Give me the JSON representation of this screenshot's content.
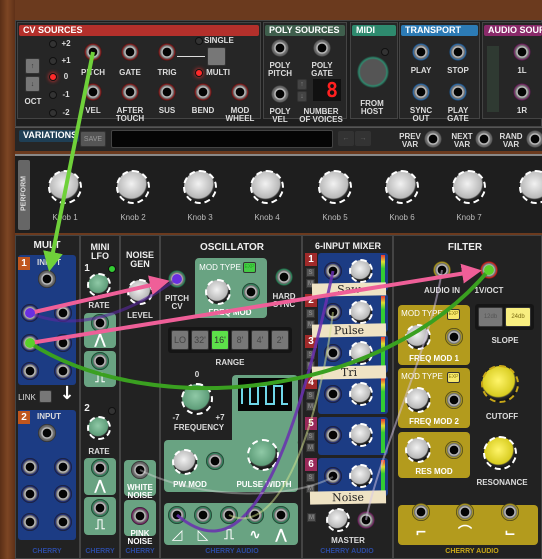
{
  "cv_sources": {
    "title": "CV SOURCES",
    "oct_label": "OCT",
    "levels": [
      "+2",
      "+1",
      "0",
      "-1",
      "-2"
    ],
    "active_level": "0",
    "pitch": "PITCH",
    "gate": "GATE",
    "trig": "TRIG",
    "single": "SINGLE",
    "multi": "MULTI",
    "vel": "VEL",
    "after_touch": "AFTER\nTOUCH",
    "sus": "SUS",
    "bend": "BEND",
    "mod_wheel": "MOD\nWHEEL"
  },
  "poly_sources": {
    "title": "POLY SOURCES",
    "poly_pitch": "POLY\nPITCH",
    "poly_gate": "POLY\nGATE",
    "poly_vel": "POLY\nVEL",
    "voices_label": "NUMBER\nOF VOICES",
    "voices": "8"
  },
  "midi": {
    "title": "MIDI",
    "from_host": "FROM\nHOST"
  },
  "transport": {
    "title": "TRANSPORT",
    "play": "PLAY",
    "stop": "STOP",
    "sync_out": "SYNC\nOUT",
    "play_gate": "PLAY\nGATE"
  },
  "audio_sources": {
    "title": "AUDIO SOURCES",
    "l": "1L",
    "r": "1R"
  },
  "variations": {
    "title": "VARIATIONS",
    "save": "SAVE",
    "name": "",
    "prev": "PREV\nVAR",
    "next": "NEXT\nVAR",
    "rand": "RAND\nVAR"
  },
  "perform": {
    "title": "PERFORM",
    "knobs": [
      "Knob 1",
      "Knob 2",
      "Knob 3",
      "Knob 4",
      "Knob 5",
      "Knob 6",
      "Knob 7"
    ]
  },
  "mult": {
    "title": "MULT",
    "ch1": "1",
    "ch2": "2",
    "input": "INPUT",
    "link": "LINK",
    "footer": "CHERRY"
  },
  "mini_lfo": {
    "title": "MINI\nLFO",
    "ch1": "1",
    "ch2": "2",
    "rate": "RATE",
    "footer": "CHERRY"
  },
  "noise_gen": {
    "title": "NOISE\nGEN",
    "level": "LEVEL",
    "white": "WHITE\nNOISE",
    "pink": "PINK\nNOISE",
    "footer": "CHERRY"
  },
  "oscillator": {
    "title": "OSCILLATOR",
    "pitch_cv": "PITCH\nCV",
    "mod_type": "MOD TYPE",
    "exp": "EXP",
    "freq_mod": "FREQ MOD",
    "hard_sync": "HARD\nSYNC",
    "range_options": [
      "LO",
      "32'",
      "16'",
      "8'",
      "4'",
      "2'"
    ],
    "range_selected": "16'",
    "range": "RANGE",
    "freq_zero": "0",
    "freq_min": "-7",
    "freq_max": "+7",
    "frequency": "FREQUENCY",
    "pw_mod": "PW MOD",
    "pulse_width": "PULSE WIDTH",
    "footer": "CHERRY AUDIO"
  },
  "mixer": {
    "title": "6-INPUT MIXER",
    "channels": [
      "1",
      "2",
      "3",
      "4",
      "5",
      "6"
    ],
    "s": "S",
    "m": "M",
    "tapes": [
      "Saw",
      "Pulse",
      "Tri",
      "Noise"
    ],
    "master": "MASTER",
    "footer": "CHERRY AUDIO"
  },
  "filter": {
    "title": "FILTER",
    "audio_in": "AUDIO IN",
    "v_oct": "1V/OCT",
    "mod_type": "MOD TYPE",
    "exp": "EXP",
    "freq_mod1": "FREQ MOD 1",
    "freq_mod2": "FREQ MOD 2",
    "res_mod": "RES MOD",
    "slope_12": "12db",
    "slope_24": "24db",
    "slope_selected": "24db",
    "slope": "SLOPE",
    "cutoff": "CUTOFF",
    "resonance": "RESONANCE",
    "footer": "CHERRY AUDIO"
  },
  "colors": {
    "cv_red": "#b3302b",
    "poly_green": "#3f5f4d",
    "midi_teal": "#2e8a6e",
    "transport_blue": "#2c7bb5",
    "audio_purple": "#8a2a6a",
    "cable_green": "#6fd13a",
    "cable_pink": "#ef5f98",
    "cable_purple": "#6a2fb0"
  }
}
